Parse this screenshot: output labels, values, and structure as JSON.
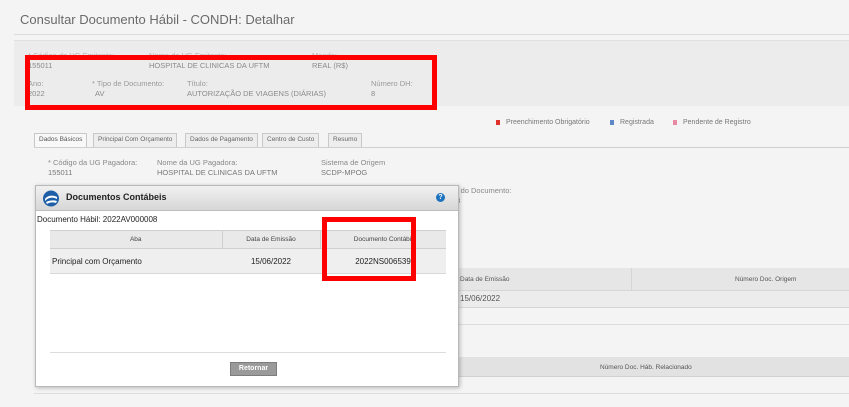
{
  "page": {
    "title": "Consultar Documento Hábil - CONDH: Detalhar"
  },
  "header": {
    "ug_emitente_label": "* Código da UG Emitente:",
    "ug_emitente_value": "155011",
    "nome_ug_label": "Nome da UG Emitente:",
    "nome_ug_value": "HOSPITAL DE CLINICAS DA UFTM",
    "moeda_label": "Moeda:",
    "moeda_value": "REAL (R$)",
    "ano_label": "Ano:",
    "ano_value": "2022",
    "tipo_label": "* Tipo de Documento:",
    "tipo_value": "AV",
    "titulo_label": "Título:",
    "titulo_value": "AUTORIZAÇÃO DE VIAGENS (DIÁRIAS)",
    "numero_dh_label": "Número DH:",
    "numero_dh_value": "8"
  },
  "legend": {
    "items": [
      {
        "label": "Preenchimento Obrigatório",
        "color": "#e0302a"
      },
      {
        "label": "Registrada",
        "color": "#5f88c6"
      },
      {
        "label": "Pendente de Registro",
        "color": "#e88aa3"
      }
    ]
  },
  "tabs": [
    {
      "label": "Dados Básicos"
    },
    {
      "label": "Principal Com Orçamento"
    },
    {
      "label": "Dados de Pagamento"
    },
    {
      "label": "Centro de Custo"
    },
    {
      "label": "Resumo"
    }
  ],
  "basic": {
    "ug_pagadora_label": "* Código da UG Pagadora:",
    "ug_pagadora_value": "155011",
    "nome_pagadora_label": "Nome da UG Pagadora:",
    "nome_pagadora_value": "HOSPITAL DE CLINICAS DA UFTM",
    "sistema_label": "Sistema de Origem",
    "sistema_value": "SCDP-MPOG",
    "doc_partial_label": "r do Documento:",
    "doc_partial_value": "3"
  },
  "bg_table": {
    "col_data_emissao": "Data de Emissão",
    "col_numero_doc_origem": "Número Doc. Origem",
    "data_emissao_value": "15/06/2022",
    "col_numero_doc_relacionado": "Número Doc. Háb. Relacionado"
  },
  "dialog": {
    "title": "Documentos Contábeis",
    "doc_habil": "Documento Hábil: 2022AV000008",
    "columns": [
      "Aba",
      "Data de Emissão",
      "Documento Contábil"
    ],
    "rows": [
      {
        "aba": "Principal com Orçamento",
        "data": "15/06/2022",
        "documento": "2022NS006539"
      }
    ],
    "retornar_label": "Retornar"
  },
  "colors": {
    "highlight": "#ff0000",
    "help_icon": "#1e73be"
  }
}
